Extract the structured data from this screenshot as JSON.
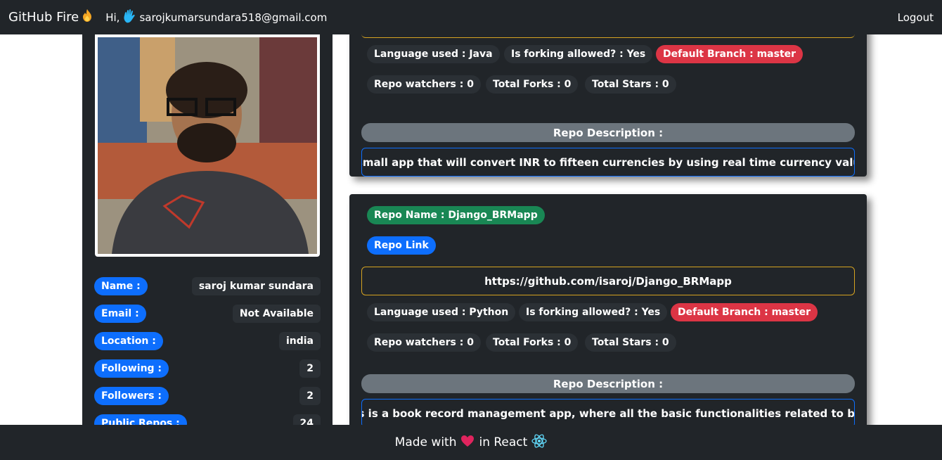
{
  "navbar": {
    "brand": "GitHub Fire",
    "brand_icon": "fire-icon",
    "greeting_prefix": "Hi,",
    "greeting_icon": "waving-hand-icon",
    "email": "sarojkumarsundara518@gmail.com",
    "logout": "Logout"
  },
  "profile": {
    "rows": [
      {
        "label": "Name :",
        "value": "saroj kumar sundara"
      },
      {
        "label": "Email :",
        "value": "Not Available"
      },
      {
        "label": "Location :",
        "value": "india"
      },
      {
        "label": "Following :",
        "value": "2"
      },
      {
        "label": "Followers :",
        "value": "2"
      },
      {
        "label": "Public Repos :",
        "value": "24"
      }
    ]
  },
  "repos": [
    {
      "language": "Language used : Java",
      "forking": "Is forking allowed? : Yes",
      "branch": "Default Branch : master",
      "watchers": "Repo watchers : 0",
      "forks": "Total Forks : 0",
      "stars": "Total Stars : 0",
      "desc_label": "Repo Description :",
      "description": "A small app that will convert INR to fifteen currencies by using real time currency value."
    },
    {
      "name": "Repo Name : Django_BRMapp",
      "link_label": "Repo Link",
      "url": "https://github.com/isaroj/Django_BRMapp",
      "language": "Language used : Python",
      "forking": "Is forking allowed? : Yes",
      "branch": "Default Branch : master",
      "watchers": "Repo watchers : 0",
      "forks": "Total Forks : 0",
      "stars": "Total Stars : 0",
      "desc_label": "Repo Description :",
      "description": "This is a book record management app, where all the basic functionalities related to book"
    }
  ],
  "footer": {
    "made_with": "Made with",
    "heart_icon": "heart-icon",
    "in_react": "in React",
    "react_icon": "react-icon"
  },
  "colors": {
    "dark": "#212529",
    "blue": "#0d6efd",
    "red": "#dc3545",
    "green": "#198754",
    "gray": "#6c757d"
  }
}
